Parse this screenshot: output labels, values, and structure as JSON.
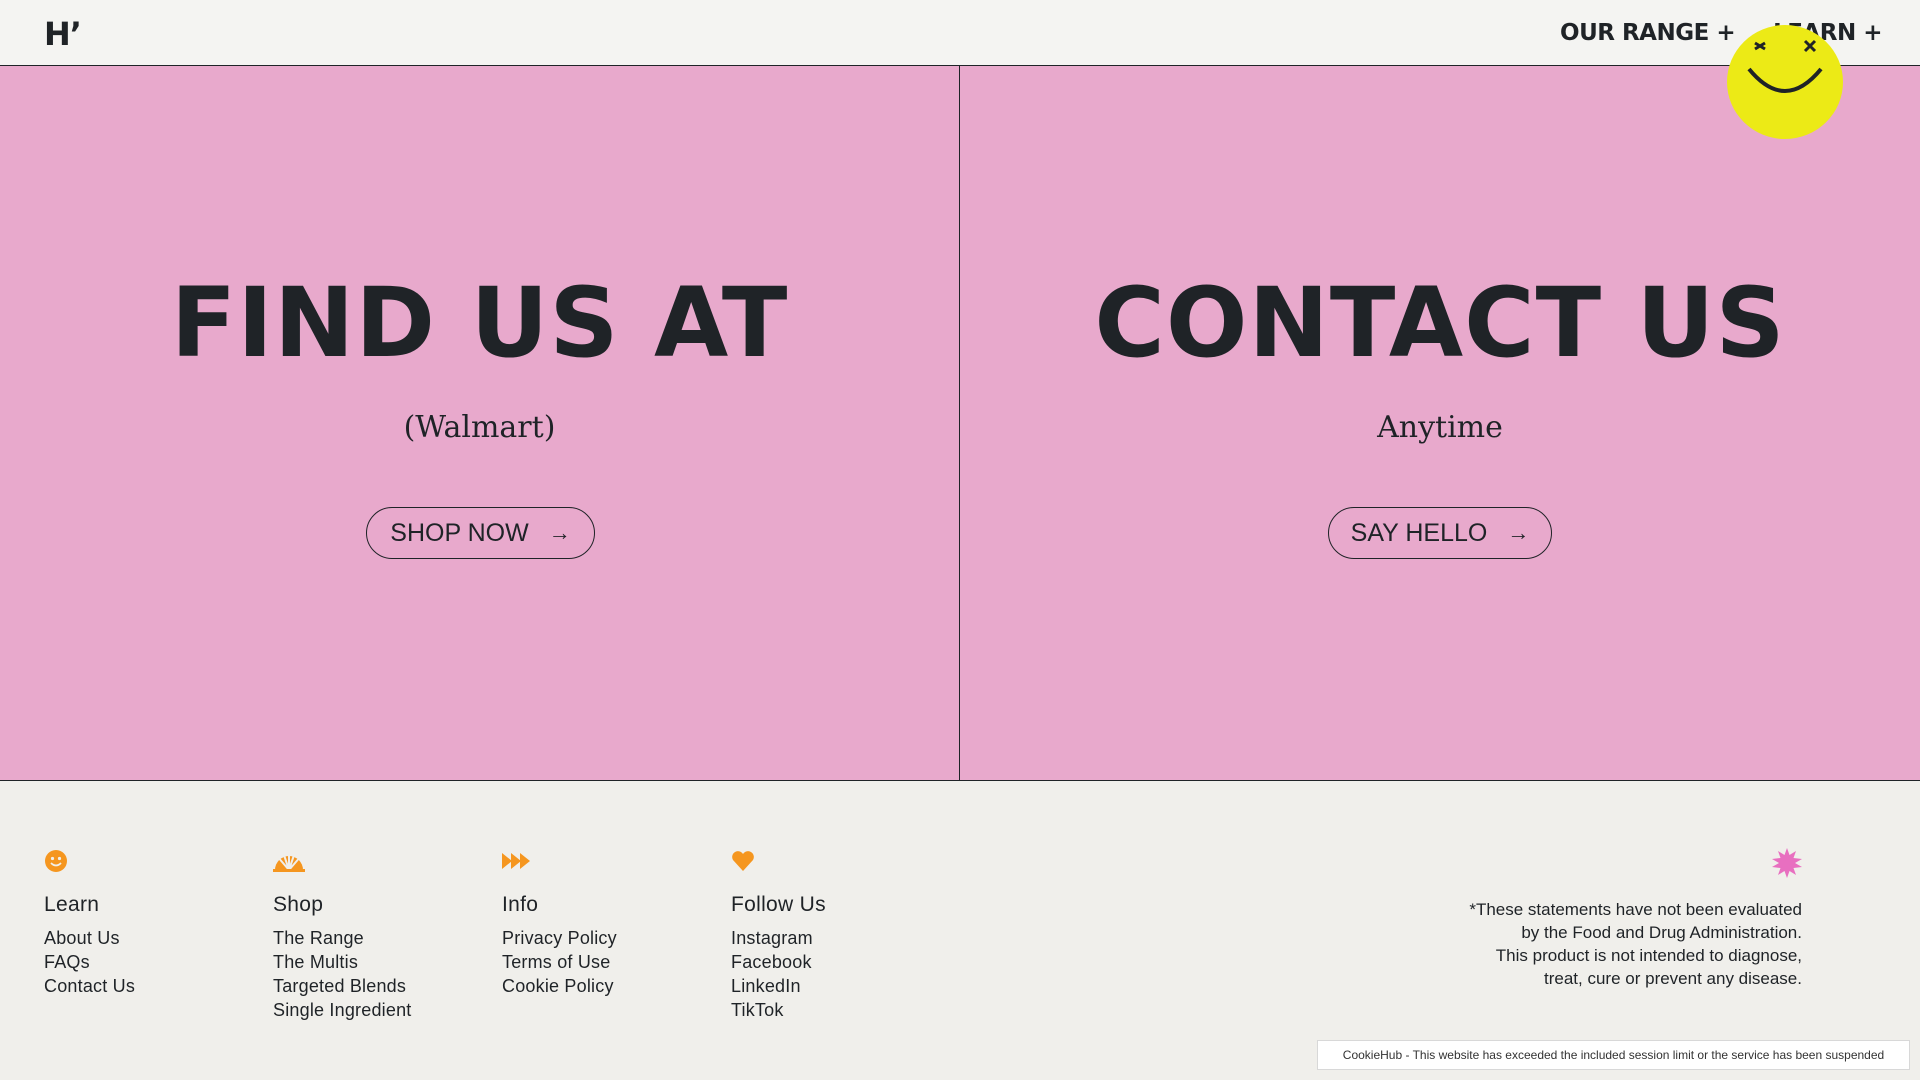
{
  "header": {
    "logo": "Hʼ",
    "nav": [
      {
        "label": "OUR RANGE +"
      },
      {
        "label": "LEARN +"
      }
    ]
  },
  "hero": {
    "left": {
      "title": "FIND US AT",
      "subtitle": "(Walmart)",
      "button": "SHOP NOW",
      "arrow": "→"
    },
    "right": {
      "title": "CONTACT US",
      "subtitle": "Anytime",
      "button": "SAY HELLO",
      "arrow": "→"
    }
  },
  "footer": {
    "columns": [
      {
        "icon": "smiley-icon",
        "heading": "Learn",
        "links": [
          "About Us",
          "FAQs",
          "Contact Us"
        ]
      },
      {
        "icon": "sunrise-icon",
        "heading": "Shop",
        "links": [
          "The Range",
          "The Multis",
          "Targeted Blends",
          "Single Ingredient"
        ]
      },
      {
        "icon": "fast-forward-icon",
        "heading": "Info",
        "links": [
          "Privacy Policy",
          "Terms of Use",
          "Cookie Policy"
        ]
      },
      {
        "icon": "heart-icon",
        "heading": "Follow Us",
        "links": [
          "Instagram",
          "Facebook",
          "LinkedIn",
          "TikTok"
        ]
      }
    ],
    "disclaimer_lines": [
      "*These statements have not been evaluated",
      "by the Food and Drug Administration.",
      "This product is not intended to diagnose,",
      "treat, cure or prevent any disease."
    ]
  },
  "cookie_notice": "CookieHub - This website has exceeded the included session limit or the service has been suspended",
  "colors": {
    "hero_bg": "#e8a9cc",
    "text": "#1f2327",
    "footer_bg": "#f0efeb",
    "accent_orange": "#f5961f",
    "accent_pink": "#e86fc0",
    "smiley_yellow": "#ecea16"
  }
}
